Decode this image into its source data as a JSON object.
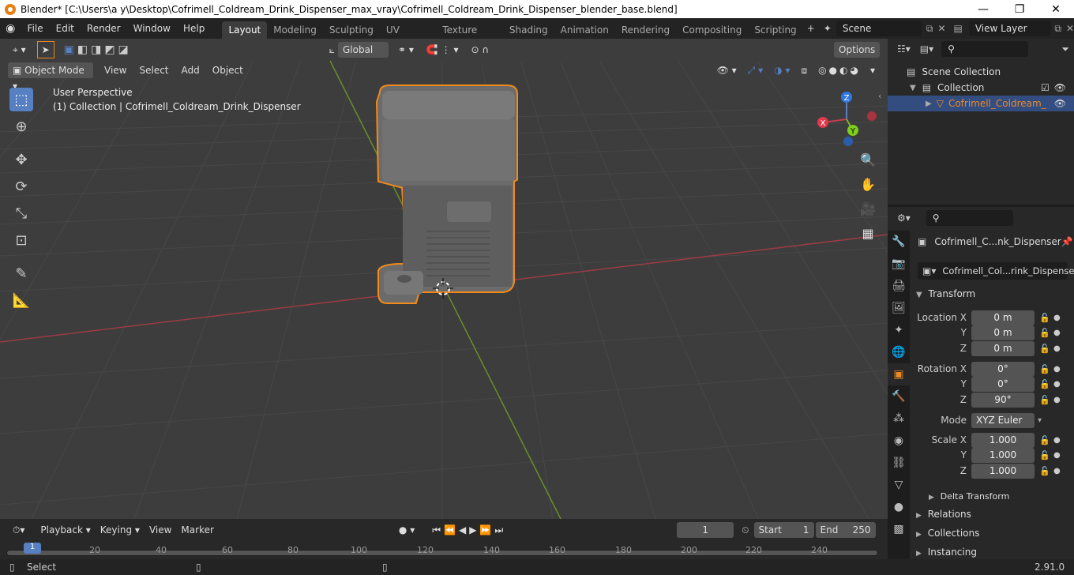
{
  "window": {
    "title": "Blender* [C:\\Users\\a y\\Desktop\\Cofrimell_Coldream_Drink_Dispenser_max_vray\\Cofrimell_Coldream_Drink_Dispenser_blender_base.blend]",
    "min": "—",
    "max": "❐",
    "close": "✕"
  },
  "menu": {
    "items": [
      "File",
      "Edit",
      "Render",
      "Window",
      "Help"
    ]
  },
  "workspaces": [
    "Layout",
    "Modeling",
    "Sculpting",
    "UV Editing",
    "Texture Paint",
    "Shading",
    "Animation",
    "Rendering",
    "Compositing",
    "Scripting"
  ],
  "scene": {
    "label": "Scene",
    "view_layer": "View Layer"
  },
  "viewport": {
    "mode": "Object Mode",
    "menus": [
      "View",
      "Select",
      "Add",
      "Object"
    ],
    "transform_orientation": "Global",
    "options": "Options",
    "info_line1": "User Perspective",
    "info_line2": "(1) Collection | Cofrimell_Coldream_Drink_Dispenser",
    "gizmo": {
      "x": "X",
      "y": "Y",
      "z": "Z"
    }
  },
  "outliner": {
    "scene_collection": "Scene Collection",
    "collection": "Collection",
    "object": "Cofrimell_Coldream_"
  },
  "properties": {
    "object_name": "Cofrimell_C...nk_Dispenser",
    "datablock": "Cofrimell_Col...rink_Dispenser",
    "transform_header": "Transform",
    "location_x_label": "Location X",
    "location_x": "0 m",
    "location_y_label": "Y",
    "location_y": "0 m",
    "location_z_label": "Z",
    "location_z": "0 m",
    "rotation_x_label": "Rotation X",
    "rotation_x": "0°",
    "rotation_y_label": "Y",
    "rotation_y": "0°",
    "rotation_z_label": "Z",
    "rotation_z": "90°",
    "mode_label": "Mode",
    "mode": "XYZ Euler",
    "scale_x_label": "Scale X",
    "scale_x": "1.000",
    "scale_y_label": "Y",
    "scale_y": "1.000",
    "scale_z_label": "Z",
    "scale_z": "1.000",
    "delta": "Delta Transform",
    "relations": "Relations",
    "collections": "Collections",
    "instancing": "Instancing"
  },
  "timeline": {
    "menus": [
      "Playback",
      "Keying",
      "View",
      "Marker"
    ],
    "current_frame": "1",
    "start_label": "Start",
    "start": "1",
    "end_label": "End",
    "end": "250",
    "ticks": [
      "1",
      "20",
      "40",
      "60",
      "80",
      "100",
      "120",
      "140",
      "160",
      "180",
      "200",
      "220",
      "240"
    ]
  },
  "status": {
    "left": "Select",
    "version": "2.91.0"
  },
  "colors": {
    "accent": "#e88a26",
    "active_blue": "#5680c2",
    "selection": "#f28a1b"
  }
}
